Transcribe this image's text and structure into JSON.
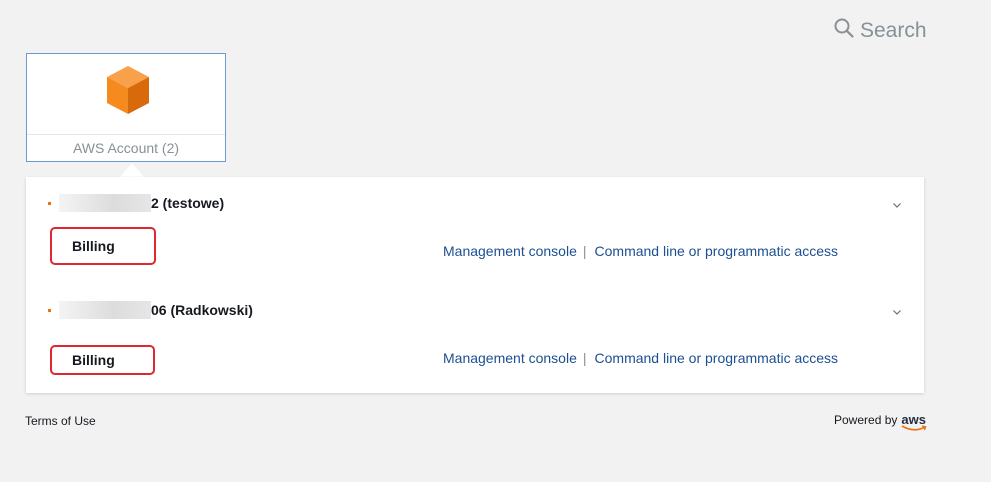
{
  "search": {
    "label": "Search",
    "icon": "search-icon"
  },
  "tile": {
    "label": "AWS Account (2)",
    "icon": "cube-icon",
    "icon_color": "#ec7211"
  },
  "accounts": [
    {
      "name": "2 (testowe)",
      "billing_label": "Billing",
      "links": {
        "console": "Management console",
        "separator": "|",
        "cli": "Command line or programmatic access"
      }
    },
    {
      "name": "06 (Radkowski)",
      "billing_label": "Billing",
      "links": {
        "console": "Management console",
        "separator": "|",
        "cli": "Command line or programmatic access"
      }
    }
  ],
  "footer": {
    "terms": "Terms of Use",
    "powered_by": "Powered by",
    "brand": "aws"
  },
  "colors": {
    "accent_orange": "#ec7211",
    "link_blue": "#1d4f91",
    "highlight_red": "#e0262f",
    "tile_border": "#6b9bd1"
  }
}
